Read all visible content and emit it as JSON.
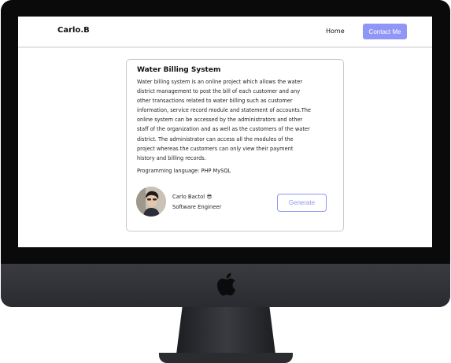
{
  "nav": {
    "brand": "Carlo.B",
    "home_label": "Home",
    "contact_label": "Contact Me"
  },
  "card": {
    "title": "Water Billing System",
    "description": "Water billing system is an online project which allows the water district management to post the bill of each customer and any other transactions related to water billing such as customer information, service record module and statement of accounts.The online system can be accessed by the administrators and other staff of the organization and as well as the customers of the water district. The administrator can access all the modules of the project whereas the customers can only view their payment history and billing records.",
    "language": "Programming language: PHP MySQL",
    "author_name": "Carlo Bactol 😎",
    "author_role": "Software Engineer",
    "generate_label": "Generate"
  },
  "colors": {
    "accent": "#8f96f5",
    "monitor_frame": "#0a0a0b",
    "chin": "#2e2f34"
  }
}
